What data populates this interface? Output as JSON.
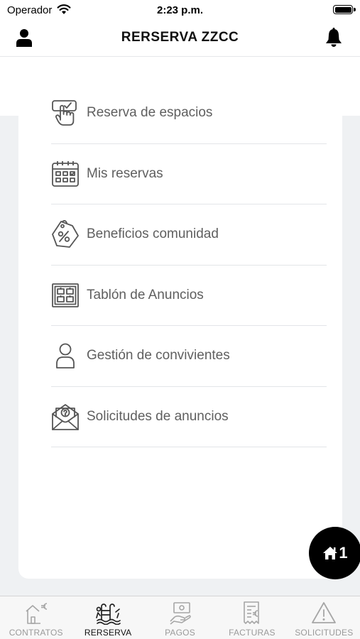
{
  "status": {
    "carrier": "Operador",
    "time": "2:23 p.m."
  },
  "header": {
    "title": "RERSERVA ZZCC",
    "left_icon": "user-icon",
    "right_icon": "bell-icon"
  },
  "menu": [
    {
      "label": "Reserva de espacios",
      "icon": "hand-tap-icon"
    },
    {
      "label": "Mis reservas",
      "icon": "calendar-icon"
    },
    {
      "label": "Beneficios comunidad",
      "icon": "discount-tag-icon"
    },
    {
      "label": "Tablón de Anuncios",
      "icon": "bulletin-board-icon"
    },
    {
      "label": "Gestión de convivientes",
      "icon": "person-icon"
    },
    {
      "label": "Solicitudes de anuncios",
      "icon": "envelope-question-icon"
    }
  ],
  "fab": {
    "count": "1",
    "icon": "home-icon"
  },
  "tabs": [
    {
      "label": "CONTRATOS",
      "icon": "house-euro-icon",
      "active": false
    },
    {
      "label": "RERSERVA ZZCC",
      "icon": "pool-icon",
      "active": true
    },
    {
      "label": "PAGOS",
      "icon": "payment-hand-icon",
      "active": false
    },
    {
      "label": "FACTURAS",
      "icon": "invoice-euro-icon",
      "active": false
    },
    {
      "label": "SOLICITUDES",
      "icon": "warning-triangle-icon",
      "active": false
    }
  ],
  "colors": {
    "accent": "#000000",
    "text_muted": "#5f5f5f",
    "background": "#eff1f3",
    "tab_inactive": "#9a9a9a"
  }
}
